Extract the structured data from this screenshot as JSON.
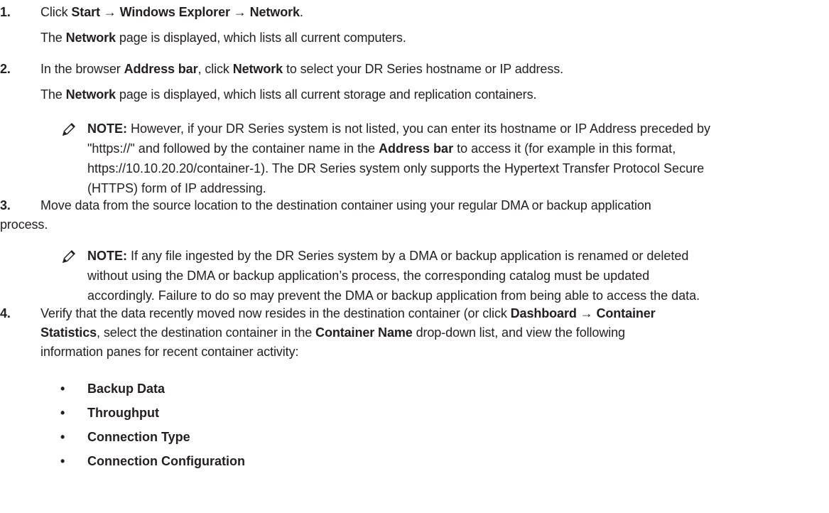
{
  "steps": [
    {
      "number": "1.",
      "line1": {
        "t1": "Click ",
        "b1": "Start",
        "t2": " → ",
        "b2": "Windows Explorer",
        "t3": " → ",
        "b3": "Network",
        "t4": "."
      },
      "line2": {
        "t1": "The ",
        "b1": "Network",
        "t2": " page is displayed, which lists all current computers."
      }
    },
    {
      "number": "2.",
      "line1": {
        "t1": "In the browser ",
        "b1": "Address bar",
        "t2": ", click ",
        "b2": "Network",
        "t3": " to select your DR Series hostname or IP address."
      },
      "line2": {
        "t1": "The ",
        "b1": "Network",
        "t2": " page is displayed, which lists all current storage and replication containers."
      }
    },
    {
      "number": "3.",
      "line1": "Move data from the source location to the destination container using your regular DMA or backup application",
      "line2": "process."
    },
    {
      "number": "4.",
      "line1": {
        "t1": "Verify that the data recently moved now resides in the destination container (or click ",
        "b1": "Dashboard",
        "t2": " → ",
        "b2": "Container"
      },
      "line2": {
        "b1": "Statistics",
        "t1": ", select the destination container in the ",
        "b2": "Container Name",
        "t2": " drop-down list, and view the following"
      },
      "line3": "information panes for recent container activity:"
    }
  ],
  "note1": {
    "label": "NOTE:",
    "line1": " However, if your DR Series system is not listed, you can enter its hostname or IP Address preceded by",
    "line2a": "\"https://\" and followed by the container name in the ",
    "line2b": "Address bar",
    "line2c": " to access it (for example in this format,",
    "line3": "https://10.10.20.20/container-1). The DR Series system only supports the Hypertext Transfer Protocol Secure",
    "line4": "(HTTPS) form of IP addressing."
  },
  "note2": {
    "label": "NOTE:",
    "line1": " If any file ingested by the DR Series system by a DMA or backup application is renamed or deleted",
    "line2": "without using the DMA or backup application’s process, the corresponding catalog must be updated",
    "line3": "accordingly. Failure to do so may prevent the DMA or backup application from being able to access the data."
  },
  "bullets": [
    "Backup Data",
    "Throughput",
    "Connection Type",
    "Connection Configuration"
  ],
  "bullet_char": "•",
  "note_icon": "pencil-note-icon"
}
